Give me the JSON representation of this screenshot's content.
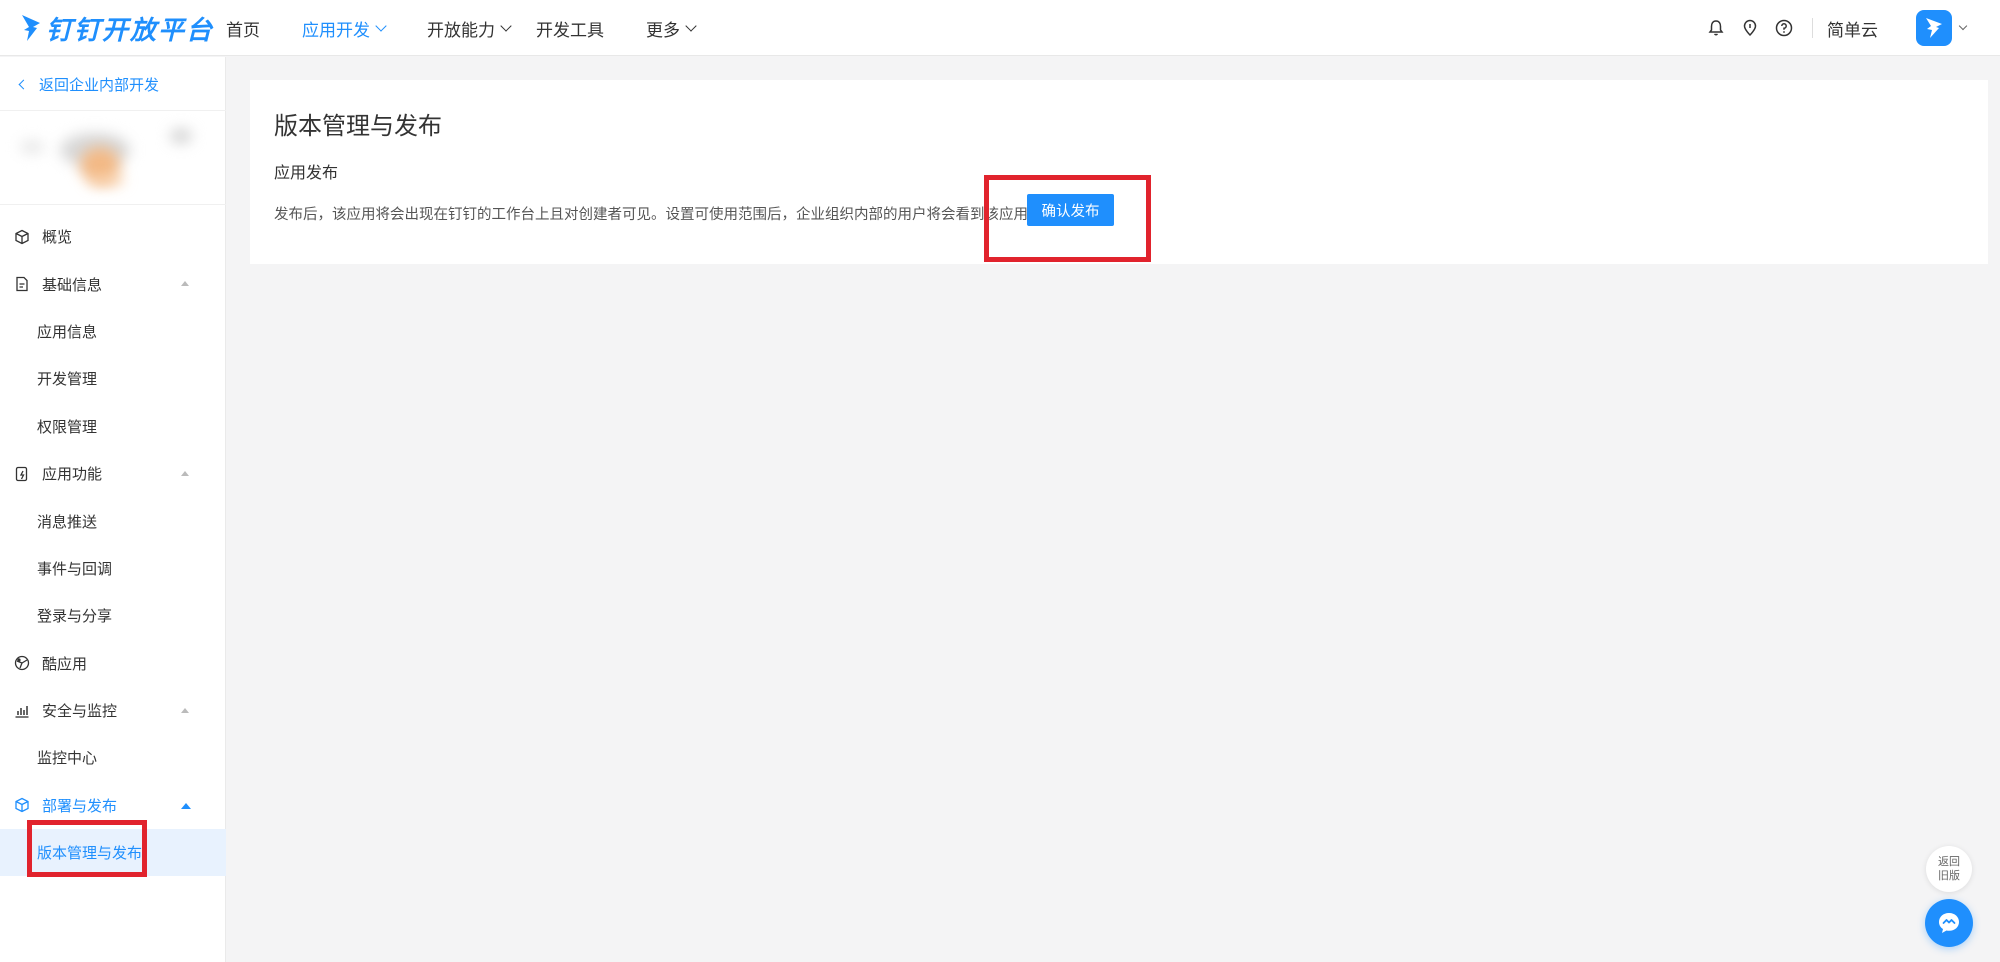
{
  "brand": {
    "name": "钉钉开放平台",
    "color": "#1f8ffd"
  },
  "nav": {
    "items": [
      {
        "label": "首页"
      },
      {
        "label": "应用开发"
      },
      {
        "label": "开放能力"
      },
      {
        "label": "开发工具"
      },
      {
        "label": "更多"
      }
    ],
    "active_index": 1
  },
  "header_right": {
    "icons": [
      "bell-icon",
      "location-icon",
      "help-icon"
    ],
    "user_name": "简单云"
  },
  "sidebar": {
    "back_label": "返回企业内部开发",
    "items": [
      {
        "label": "概览",
        "icon": "cube-icon"
      },
      {
        "label": "基础信息",
        "icon": "document-icon"
      },
      {
        "label": "应用信息"
      },
      {
        "label": "开发管理"
      },
      {
        "label": "权限管理"
      },
      {
        "label": "应用功能",
        "icon": "app-function-icon"
      },
      {
        "label": "消息推送"
      },
      {
        "label": "事件与回调"
      },
      {
        "label": "登录与分享"
      },
      {
        "label": "酷应用",
        "icon": "cool-app-icon"
      },
      {
        "label": "安全与监控",
        "icon": "bar-chart-icon"
      },
      {
        "label": "监控中心"
      },
      {
        "label": "部署与发布",
        "icon": "deploy-icon"
      },
      {
        "label": "版本管理与发布"
      }
    ],
    "selected": "版本管理与发布"
  },
  "main": {
    "title": "版本管理与发布",
    "section_title": "应用发布",
    "description": "发布后，该应用将会出现在钉钉的工作台上且对创建者可见。设置可使用范围后，企业组织内部的用户将会看到该应用。",
    "confirm_button": "确认发布"
  },
  "floating": {
    "return_old": "返回旧版"
  },
  "colors": {
    "accent": "#1f8ffd",
    "highlight": "#e1232d",
    "background": "#f4f4f5"
  }
}
